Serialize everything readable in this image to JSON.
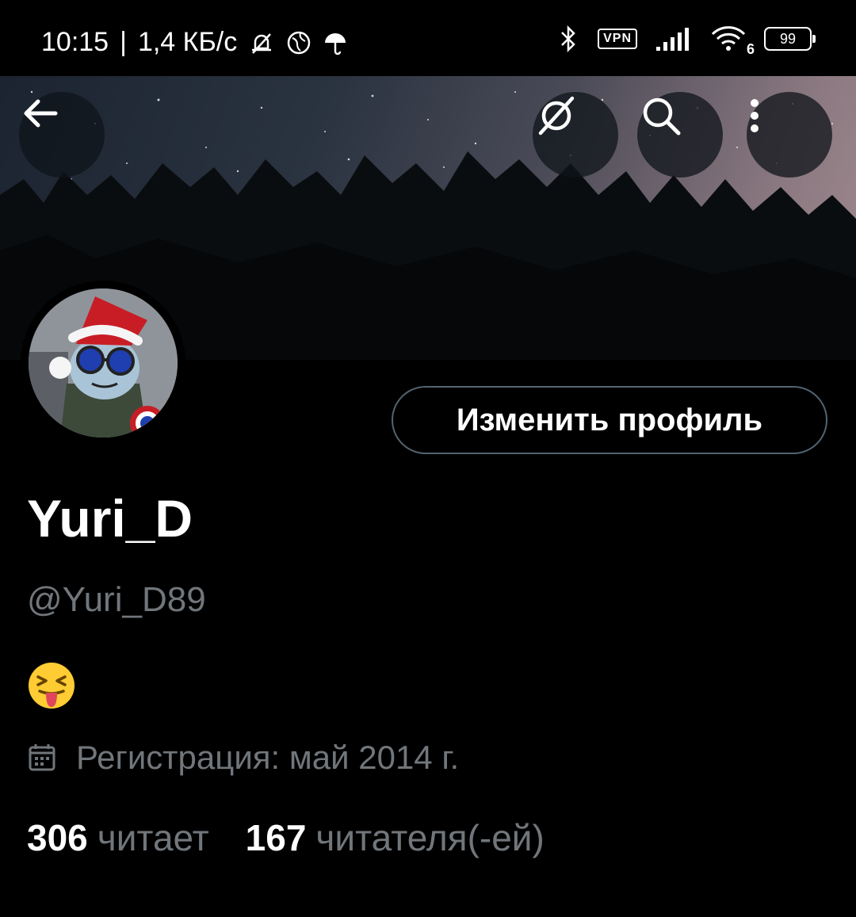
{
  "status_bar": {
    "time": "10:15",
    "net_speed": "1,4 КБ/с",
    "vpn": "VPN",
    "wifi_sub": "6",
    "battery": "99"
  },
  "header": {
    "back_icon": "back-arrow-icon",
    "actions": [
      "explore-slash-icon",
      "search-icon",
      "more-vertical-icon"
    ]
  },
  "profile": {
    "edit_button": "Изменить профиль",
    "display_name": "Yuri_D",
    "handle": "@Yuri_D89",
    "joined": "Регистрация: май 2014 г.",
    "following_count": "306",
    "following_label": "читает",
    "followers_count": "167",
    "followers_label": "читателя(-ей)"
  },
  "colors": {
    "background": "#000000",
    "secondary_text": "#71767b",
    "button_border": "#536471"
  }
}
